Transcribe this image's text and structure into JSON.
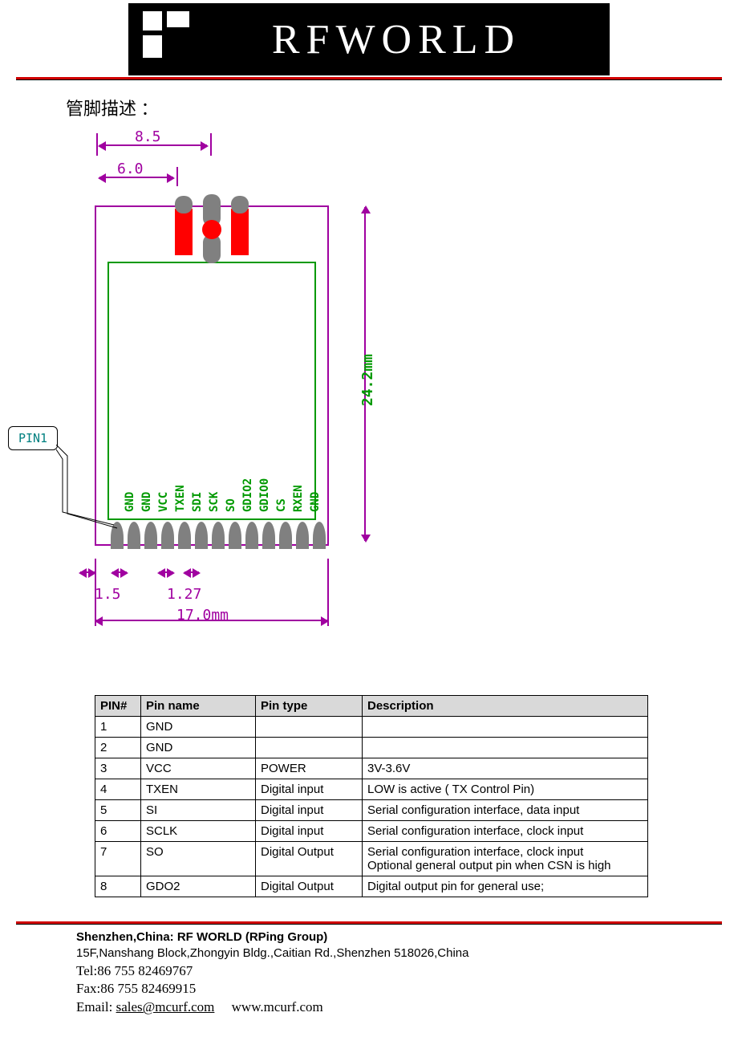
{
  "header": {
    "brand": "RFWORLD"
  },
  "section_title": "管脚描述 ：",
  "diagram": {
    "dim_top1": "8.5",
    "dim_top2": "6.0",
    "dim_height": "24.2mm",
    "dim_width": "17.0mm",
    "dim_pad_offset": "1.5",
    "dim_pad_pitch": "1.27",
    "callout": "PIN1",
    "pin_labels": [
      "GND",
      "GND",
      "VCC",
      "TXEN",
      "SDI",
      "SCK",
      "SO",
      "GDIO2",
      "GDIO0",
      "CS",
      "RXEN",
      "GND"
    ]
  },
  "table": {
    "headers": [
      "PIN#",
      "Pin name",
      "Pin type",
      "Description"
    ],
    "rows": [
      {
        "num": "1",
        "name": "GND",
        "type": "",
        "desc": ""
      },
      {
        "num": "2",
        "name": "GND",
        "type": "",
        "desc": ""
      },
      {
        "num": "3",
        "name": "VCC",
        "type": "POWER",
        "desc": "3V-3.6V"
      },
      {
        "num": "4",
        "name": "TXEN",
        "type": "Digital input",
        "desc": "LOW is active ( TX Control Pin)"
      },
      {
        "num": "5",
        "name": "SI",
        "type": "Digital input",
        "desc": "Serial configuration interface, data input"
      },
      {
        "num": "6",
        "name": "SCLK",
        "type": "Digital input",
        "desc": "Serial configuration interface, clock input"
      },
      {
        "num": "7",
        "name": "SO",
        "type": "Digital Output",
        "desc": "Serial configuration interface, clock input\nOptional general output pin when CSN is high"
      },
      {
        "num": "8",
        "name": "GDO2",
        "type": "Digital Output",
        "desc": "Digital output pin for general use;"
      }
    ]
  },
  "footer": {
    "line1": "Shenzhen,China: RF WORLD (RPing Group)",
    "line2": "15F,Nanshang Block,Zhongyin Bldg.,Caitian Rd.,Shenzhen 518026,China",
    "tel": "Tel:86 755    82469767",
    "fax": "Fax:86 755 82469915",
    "email_label": "Email: ",
    "email": "sales@mcurf.com",
    "web": "www.mcurf.com"
  }
}
